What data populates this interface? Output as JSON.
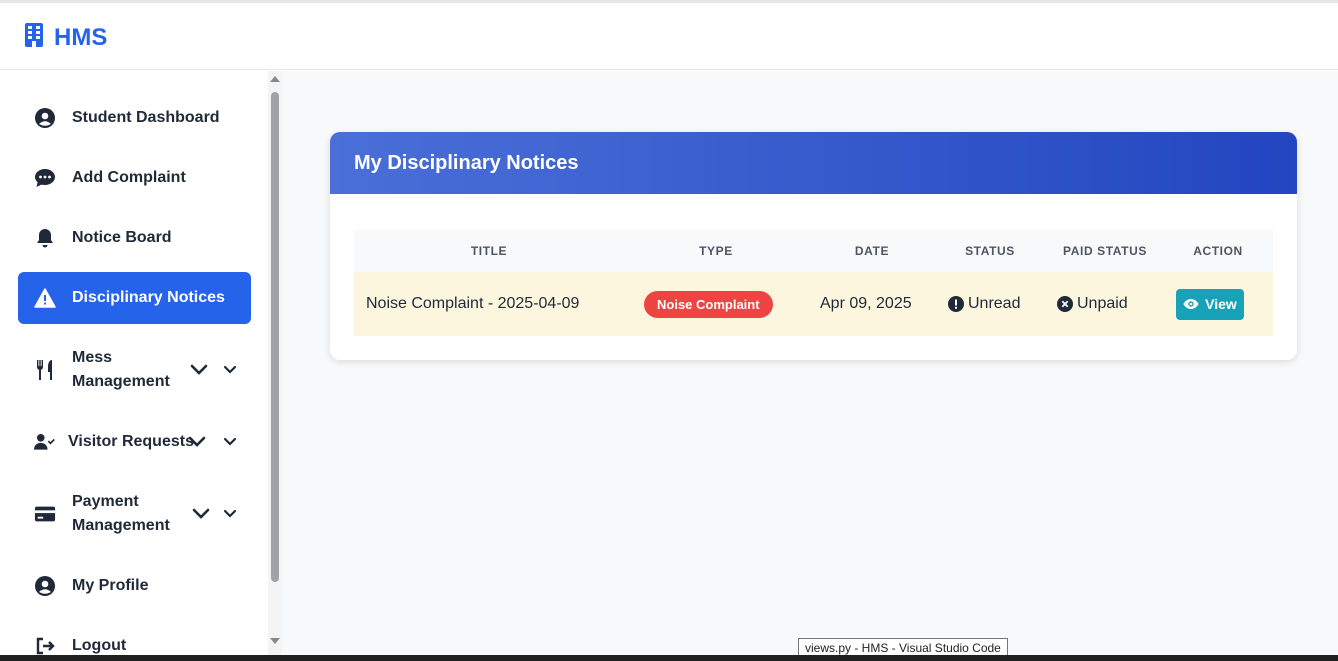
{
  "app": {
    "name": "HMS"
  },
  "sidebar": {
    "items": [
      {
        "label": "Student Dashboard",
        "icon": "user-circle-icon"
      },
      {
        "label": "Add Complaint",
        "icon": "chat-bubble-icon"
      },
      {
        "label": "Notice Board",
        "icon": "bell-icon"
      },
      {
        "label": "Disciplinary Notices",
        "icon": "warning-icon",
        "active": true
      },
      {
        "label": "Mess Management",
        "icon": "utensils-icon",
        "dropdown": true
      },
      {
        "label": "Visitor Requests",
        "icon": "user-check-icon",
        "dropdown": true
      },
      {
        "label": "Payment Management",
        "icon": "credit-card-icon",
        "dropdown": true
      },
      {
        "label": "My Profile",
        "icon": "user-circle-icon"
      },
      {
        "label": "Logout",
        "icon": "logout-icon"
      }
    ]
  },
  "card": {
    "title": "My Disciplinary Notices"
  },
  "table": {
    "columns": [
      "TITLE",
      "TYPE",
      "DATE",
      "STATUS",
      "PAID STATUS",
      "ACTION"
    ],
    "rows": [
      {
        "title": "Noise Complaint - 2025-04-09",
        "type": "Noise Complaint",
        "date": "Apr 09, 2025",
        "status": "Unread",
        "paid_status": "Unpaid",
        "action": "View"
      }
    ]
  },
  "taskbar": {
    "tooltip": "views.py - HMS - Visual Studio Code"
  },
  "colors": {
    "primary": "#2563eb",
    "danger": "#ef4444",
    "info": "#17a2b8",
    "row_highlight": "#fdf6df"
  }
}
